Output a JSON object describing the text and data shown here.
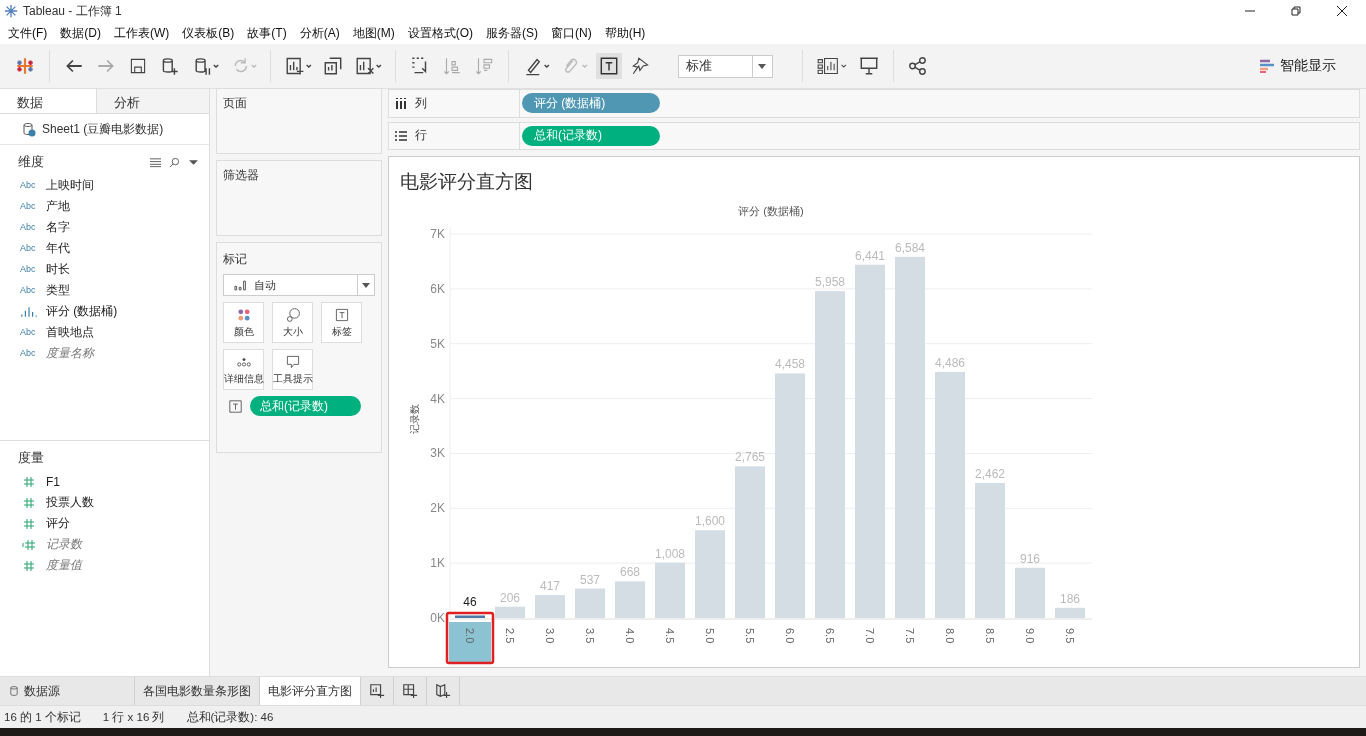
{
  "window": {
    "title": "Tableau - 工作簿 1"
  },
  "menu": [
    "文件(F)",
    "数据(D)",
    "工作表(W)",
    "仪表板(B)",
    "故事(T)",
    "分析(A)",
    "地图(M)",
    "设置格式(O)",
    "服务器(S)",
    "窗口(N)",
    "帮助(H)"
  ],
  "toolbar": {
    "fit_dropdown": "标准",
    "show_me": "智能显示"
  },
  "side_tabs": [
    {
      "label": "数据",
      "selected": true
    },
    {
      "label": "分析",
      "selected": false
    }
  ],
  "datasource": "Sheet1 (豆瓣电影数据)",
  "dimensions": {
    "title": "维度",
    "items": [
      {
        "kind": "string",
        "type_label": "Abc",
        "name": "上映时间",
        "generated": false
      },
      {
        "kind": "string",
        "type_label": "Abc",
        "name": "产地",
        "generated": false
      },
      {
        "kind": "string",
        "type_label": "Abc",
        "name": "名字",
        "generated": false
      },
      {
        "kind": "string",
        "type_label": "Abc",
        "name": "年代",
        "generated": false
      },
      {
        "kind": "string",
        "type_label": "Abc",
        "name": "时长",
        "generated": false
      },
      {
        "kind": "string",
        "type_label": "Abc",
        "name": "类型",
        "generated": false
      },
      {
        "kind": "bin",
        "name": "评分 (数据桶)",
        "generated": false
      },
      {
        "kind": "string",
        "type_label": "Abc",
        "name": "首映地点",
        "generated": false
      },
      {
        "kind": "string",
        "type_label": "Abc",
        "name": "度量名称",
        "generated": true
      }
    ]
  },
  "measures": {
    "title": "度量",
    "items": [
      {
        "kind": "number",
        "name": "F1",
        "generated": false
      },
      {
        "kind": "number",
        "name": "投票人数",
        "generated": false
      },
      {
        "kind": "number",
        "name": "评分",
        "generated": false
      },
      {
        "kind": "count",
        "name": "记录数",
        "generated": true
      },
      {
        "kind": "number",
        "name": "度量值",
        "generated": true
      }
    ]
  },
  "pages_card": {
    "title": "页面"
  },
  "filters_card": {
    "title": "筛选器"
  },
  "marks_card": {
    "title": "标记",
    "mark_type": "自动",
    "buttons": [
      {
        "kind": "color",
        "label": "颜色"
      },
      {
        "kind": "size",
        "label": "大小"
      },
      {
        "kind": "label",
        "label": "标签"
      },
      {
        "kind": "detail",
        "label": "详细信息"
      },
      {
        "kind": "tooltip",
        "label": "工具提示"
      }
    ],
    "fields": [
      {
        "kind": "measure",
        "name": "总和(记录数)"
      }
    ]
  },
  "shelves": [
    {
      "kind": "columns",
      "label": "列",
      "pills": [
        {
          "kind": "dimension",
          "name": "评分 (数据桶)"
        }
      ]
    },
    {
      "kind": "rows",
      "label": "行",
      "pills": [
        {
          "kind": "measure",
          "name": "总和(记录数)"
        }
      ]
    }
  ],
  "view": {
    "title": "电影评分直方图",
    "selected_category": "2.0",
    "chart_data": {
      "type": "bar",
      "title": "评分 (数据桶)",
      "ylabel": "记录数",
      "grid": true,
      "categories": [
        "2.0",
        "2.5",
        "3.0",
        "3.5",
        "4.0",
        "4.5",
        "5.0",
        "5.5",
        "6.0",
        "6.5",
        "7.0",
        "7.5",
        "8.0",
        "8.5",
        "9.0",
        "9.5"
      ],
      "values": [
        46,
        206,
        417,
        537,
        668,
        1008,
        1600,
        2765,
        4458,
        5958,
        6441,
        6584,
        4486,
        2462,
        916,
        186
      ],
      "value_labels": [
        "46",
        "206",
        "417",
        "537",
        "668",
        "1,008",
        "1,600",
        "2,765",
        "4,458",
        "5,958",
        "6,441",
        "6,584",
        "4,486",
        "2,462",
        "916",
        "186"
      ],
      "ylim": [
        0,
        7000
      ],
      "yticks": [
        {
          "value": 0,
          "label": "0K"
        },
        {
          "value": 1000,
          "label": "1K"
        },
        {
          "value": 2000,
          "label": "2K"
        },
        {
          "value": 3000,
          "label": "3K"
        },
        {
          "value": 4000,
          "label": "4K"
        },
        {
          "value": 5000,
          "label": "5K"
        },
        {
          "value": 6000,
          "label": "6K"
        },
        {
          "value": 7000,
          "label": "7K"
        }
      ]
    }
  },
  "sheet_tabs": [
    {
      "kind": "datasource",
      "label": "数据源",
      "selected": false
    },
    {
      "kind": "sheet",
      "label": "各国电影数量条形图",
      "selected": false
    },
    {
      "kind": "sheet",
      "label": "电影评分直方图",
      "selected": true
    }
  ],
  "status_bar": [
    "16 的 1 个标记",
    "1 行 x 16 列",
    "总和(记录数): 46"
  ]
}
